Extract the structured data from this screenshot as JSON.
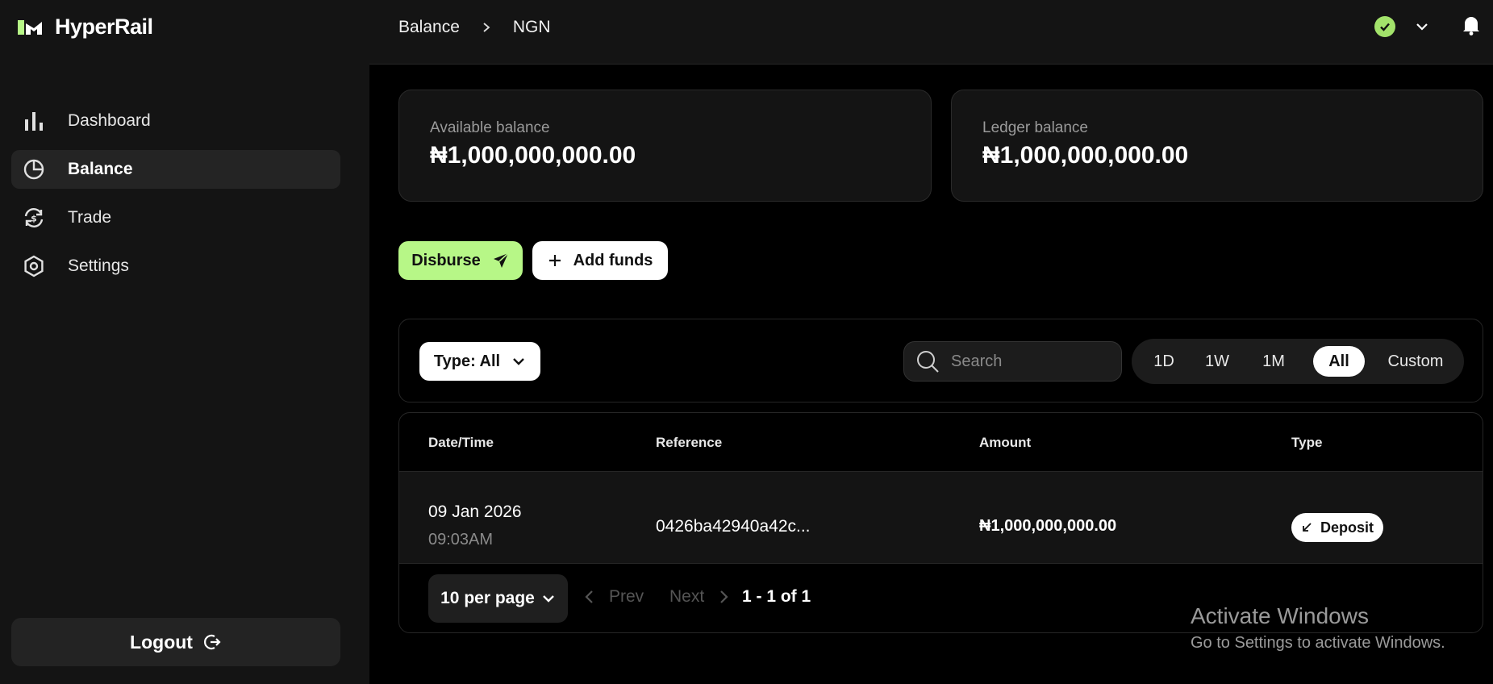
{
  "app": {
    "name": "HyperRail"
  },
  "sidebar": {
    "items": [
      {
        "label": "Dashboard",
        "icon": "bar-chart-icon"
      },
      {
        "label": "Balance",
        "icon": "pie-chart-icon",
        "active": true
      },
      {
        "label": "Trade",
        "icon": "exchange-icon"
      },
      {
        "label": "Settings",
        "icon": "hexagon-settings-icon"
      }
    ],
    "logout_label": "Logout"
  },
  "topbar": {
    "breadcrumb": [
      "Balance",
      "NGN"
    ],
    "status_color": "#a3e36b"
  },
  "balances": {
    "available_label": "Available balance",
    "available_value": "₦1,000,000,000.00",
    "ledger_label": "Ledger balance",
    "ledger_value": "₦1,000,000,000.00"
  },
  "actions": {
    "disburse_label": "Disburse",
    "add_funds_label": "Add funds",
    "accent_color": "#b7f787"
  },
  "filters": {
    "type_label": "Type: All",
    "search_placeholder": "Search",
    "ranges": [
      "1D",
      "1W",
      "1M",
      "All",
      "Custom"
    ],
    "active_range": "All"
  },
  "table": {
    "columns": [
      "Date/Time",
      "Reference",
      "Amount",
      "Type"
    ],
    "rows": [
      {
        "date": "09 Jan 2026",
        "time": "09:03AM",
        "reference": "0426ba42940a42c...",
        "amount": "₦1,000,000,000.00",
        "type": "Deposit"
      }
    ]
  },
  "pagination": {
    "per_page": "10 per page",
    "prev": "Prev",
    "next": "Next",
    "info": "1 - 1 of 1"
  },
  "watermark": {
    "title": "Activate Windows",
    "subtitle": "Go to Settings to activate Windows."
  }
}
